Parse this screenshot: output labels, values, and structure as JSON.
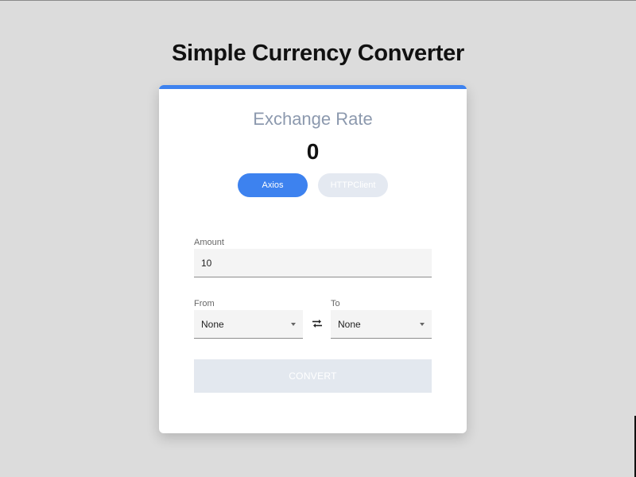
{
  "header": {
    "title": "Simple Currency Converter"
  },
  "rate": {
    "label": "Exchange Rate",
    "value": "0"
  },
  "toggle": {
    "axios_label": "Axios",
    "httpclient_label": "HTTPClient",
    "active": "Axios"
  },
  "amount": {
    "label": "Amount",
    "value": "10"
  },
  "from": {
    "label": "From",
    "value": "None"
  },
  "to": {
    "label": "To",
    "value": "None"
  },
  "convert": {
    "label": "CONVERT"
  },
  "colors": {
    "accent": "#3d82ef",
    "background": "#dcdcdc",
    "disabled": "#e3e8ef",
    "muted_text": "#8c99ae"
  },
  "icons": {
    "swap": "swap-arrows-icon",
    "dropdown": "chevron-down-icon"
  }
}
